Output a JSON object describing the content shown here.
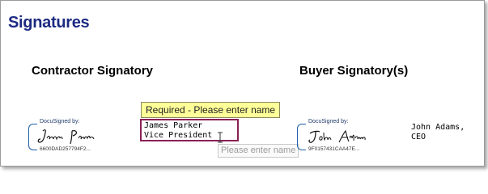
{
  "page": {
    "title": "Signatures"
  },
  "contractor": {
    "heading": "Contractor Signatory",
    "signature": {
      "label": "DocuSigned by:",
      "signature_name": "James Parker",
      "envelope_id": "6600DAD257794F2..."
    },
    "tooltip": "Required - Please enter name",
    "name_field": {
      "lines": [
        "James Parker",
        "Vice President"
      ],
      "placeholder": "Please enter name"
    }
  },
  "buyer": {
    "heading": "Buyer Signatory(s)",
    "signature": {
      "label": "DocuSigned by:",
      "signature_name": "John Adams",
      "envelope_id": "9F0157431CAA47E..."
    },
    "name_lines": [
      "John Adams,",
      "CEO"
    ]
  },
  "colors": {
    "title": "#1c2a82",
    "docusign_bracket": "#1f5fa8",
    "input_border": "#8a2055",
    "tooltip_bg": "#ffff99"
  }
}
